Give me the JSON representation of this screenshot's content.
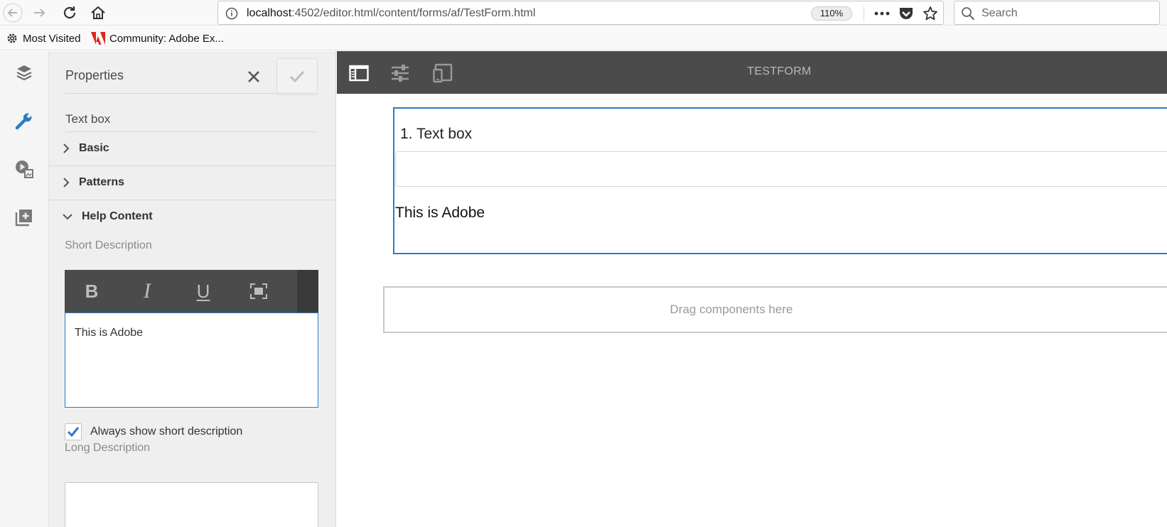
{
  "browser": {
    "url_host": "localhost",
    "url_path": ":4502/editor.html/content/forms/af/TestForm.html",
    "zoom": "110%",
    "search_placeholder": "Search",
    "bookmarks": [
      {
        "label": "Most Visited"
      },
      {
        "label": "Community: Adobe Ex..."
      }
    ]
  },
  "panel": {
    "title": "Properties",
    "component_name": "Text box",
    "sections": [
      {
        "label": "Basic",
        "expanded": false
      },
      {
        "label": "Patterns",
        "expanded": false
      },
      {
        "label": "Help Content",
        "expanded": true
      }
    ],
    "short_description_label": "Short Description",
    "rte_buttons": {
      "bold": "B",
      "italic": "I",
      "underline": "U"
    },
    "short_description_value": "This is Adobe",
    "always_show_label": "Always show short description",
    "always_show_checked": true,
    "long_description_label": "Long Description"
  },
  "editor": {
    "form_title": "TESTFORM",
    "field_label": "1. Text box",
    "field_help": "This is Adobe",
    "drop_zone": "Drag components here"
  },
  "colors": {
    "accent": "#2d7bc2",
    "toolbar_dark": "#4b4b4b",
    "panel_bg": "#efefef"
  },
  "icons": {
    "rail": [
      "layers-icon",
      "wrench-icon",
      "media-icon",
      "add-component-icon"
    ],
    "editor_toolbar": [
      "side-panel-toggle-icon",
      "page-properties-icon",
      "emulator-icon"
    ]
  }
}
